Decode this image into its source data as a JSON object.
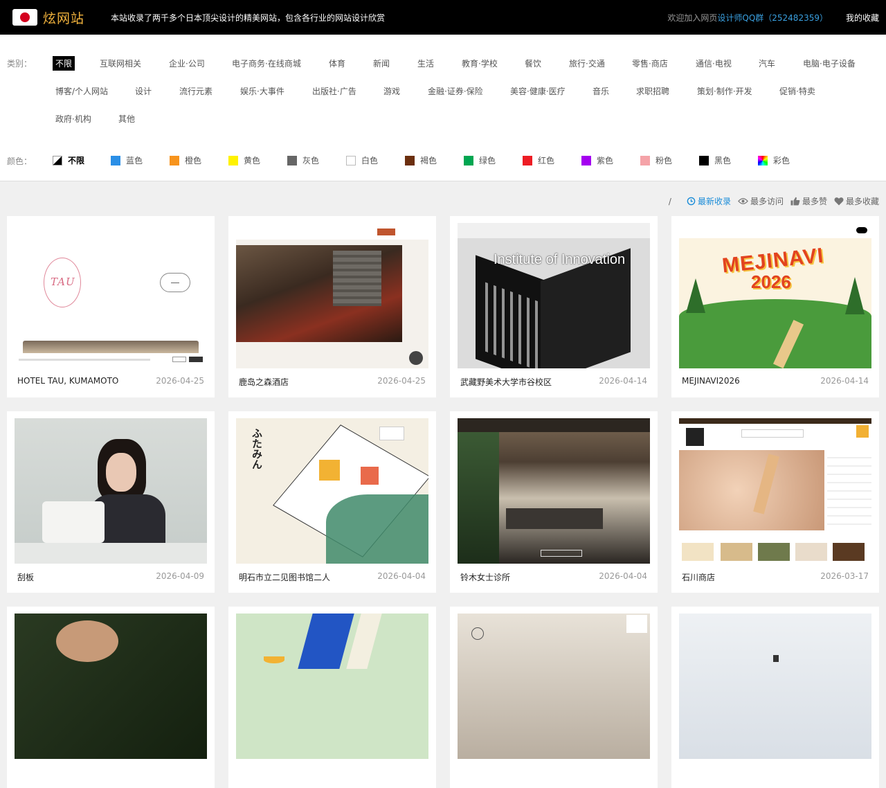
{
  "header": {
    "logo_text": "炫网站",
    "tagline": "本站收录了两千多个日本顶尖设计的精美网站，包含各行业的网站设计欣赏",
    "welcome": "欢迎加入网页",
    "qq_link": "设计师QQ群（252482359）",
    "my_favorites": "我的收藏"
  },
  "filters": {
    "category_label": "类别：",
    "categories": [
      "不限",
      "互联网相关",
      "企业·公司",
      "电子商务·在线商城",
      "体育",
      "新闻",
      "生活",
      "教育·学校",
      "餐饮",
      "旅行·交通",
      "零售·商店",
      "通信·电视",
      "汽车",
      "电脑·电子设备",
      "博客/个人网站",
      "设计",
      "流行元素",
      "娱乐·大事件",
      "出版社·广告",
      "游戏",
      "金融·证券·保险",
      "美容·健康·医疗",
      "音乐",
      "求职招聘",
      "策划·制作·开发",
      "促销·特卖",
      "政府·机构",
      "其他"
    ],
    "color_label": "颜色：",
    "colors": [
      {
        "label": "不限",
        "swatch": "none"
      },
      {
        "label": "蓝色",
        "swatch": "#2b8fe6"
      },
      {
        "label": "橙色",
        "swatch": "#f7941d"
      },
      {
        "label": "黄色",
        "swatch": "#fff200"
      },
      {
        "label": "灰色",
        "swatch": "#666666"
      },
      {
        "label": "白色",
        "swatch": "white"
      },
      {
        "label": "褐色",
        "swatch": "#6b2f0e"
      },
      {
        "label": "绿色",
        "swatch": "#00a651"
      },
      {
        "label": "红色",
        "swatch": "#ed1c24"
      },
      {
        "label": "紫色",
        "swatch": "#a400f0"
      },
      {
        "label": "粉色",
        "swatch": "#f5a3a8"
      },
      {
        "label": "黑色",
        "swatch": "#000000"
      },
      {
        "label": "彩色",
        "swatch": "rainbow"
      }
    ]
  },
  "sort": {
    "separator": "/",
    "items": [
      "最新收录",
      "最多访问",
      "最多赞",
      "最多收藏"
    ]
  },
  "cards": [
    {
      "title": "HOTEL TAU, KUMAMOTO",
      "date": "2026-04-25"
    },
    {
      "title": "鹿岛之森酒店",
      "date": "2026-04-25"
    },
    {
      "title": "武藏野美术大学市谷校区",
      "date": "2026-04-14"
    },
    {
      "title": "MEJINAVI2026",
      "date": "2026-04-14"
    },
    {
      "title": "刮板",
      "date": "2026-04-09"
    },
    {
      "title": "明石市立二见图书馆二人",
      "date": "2026-04-04"
    },
    {
      "title": "铃木女士诊所",
      "date": "2026-04-04"
    },
    {
      "title": "石川商店",
      "date": "2026-03-17"
    },
    {
      "title": "",
      "date": ""
    },
    {
      "title": "",
      "date": ""
    },
    {
      "title": "",
      "date": ""
    },
    {
      "title": "",
      "date": ""
    }
  ],
  "thumb_text": {
    "tau_logo": "TAU",
    "mau_headline": "Institute of Innovation",
    "mejinavi_title": "MEJINAVI",
    "mejinavi_year": "2026",
    "library_title": "ふたみん"
  }
}
